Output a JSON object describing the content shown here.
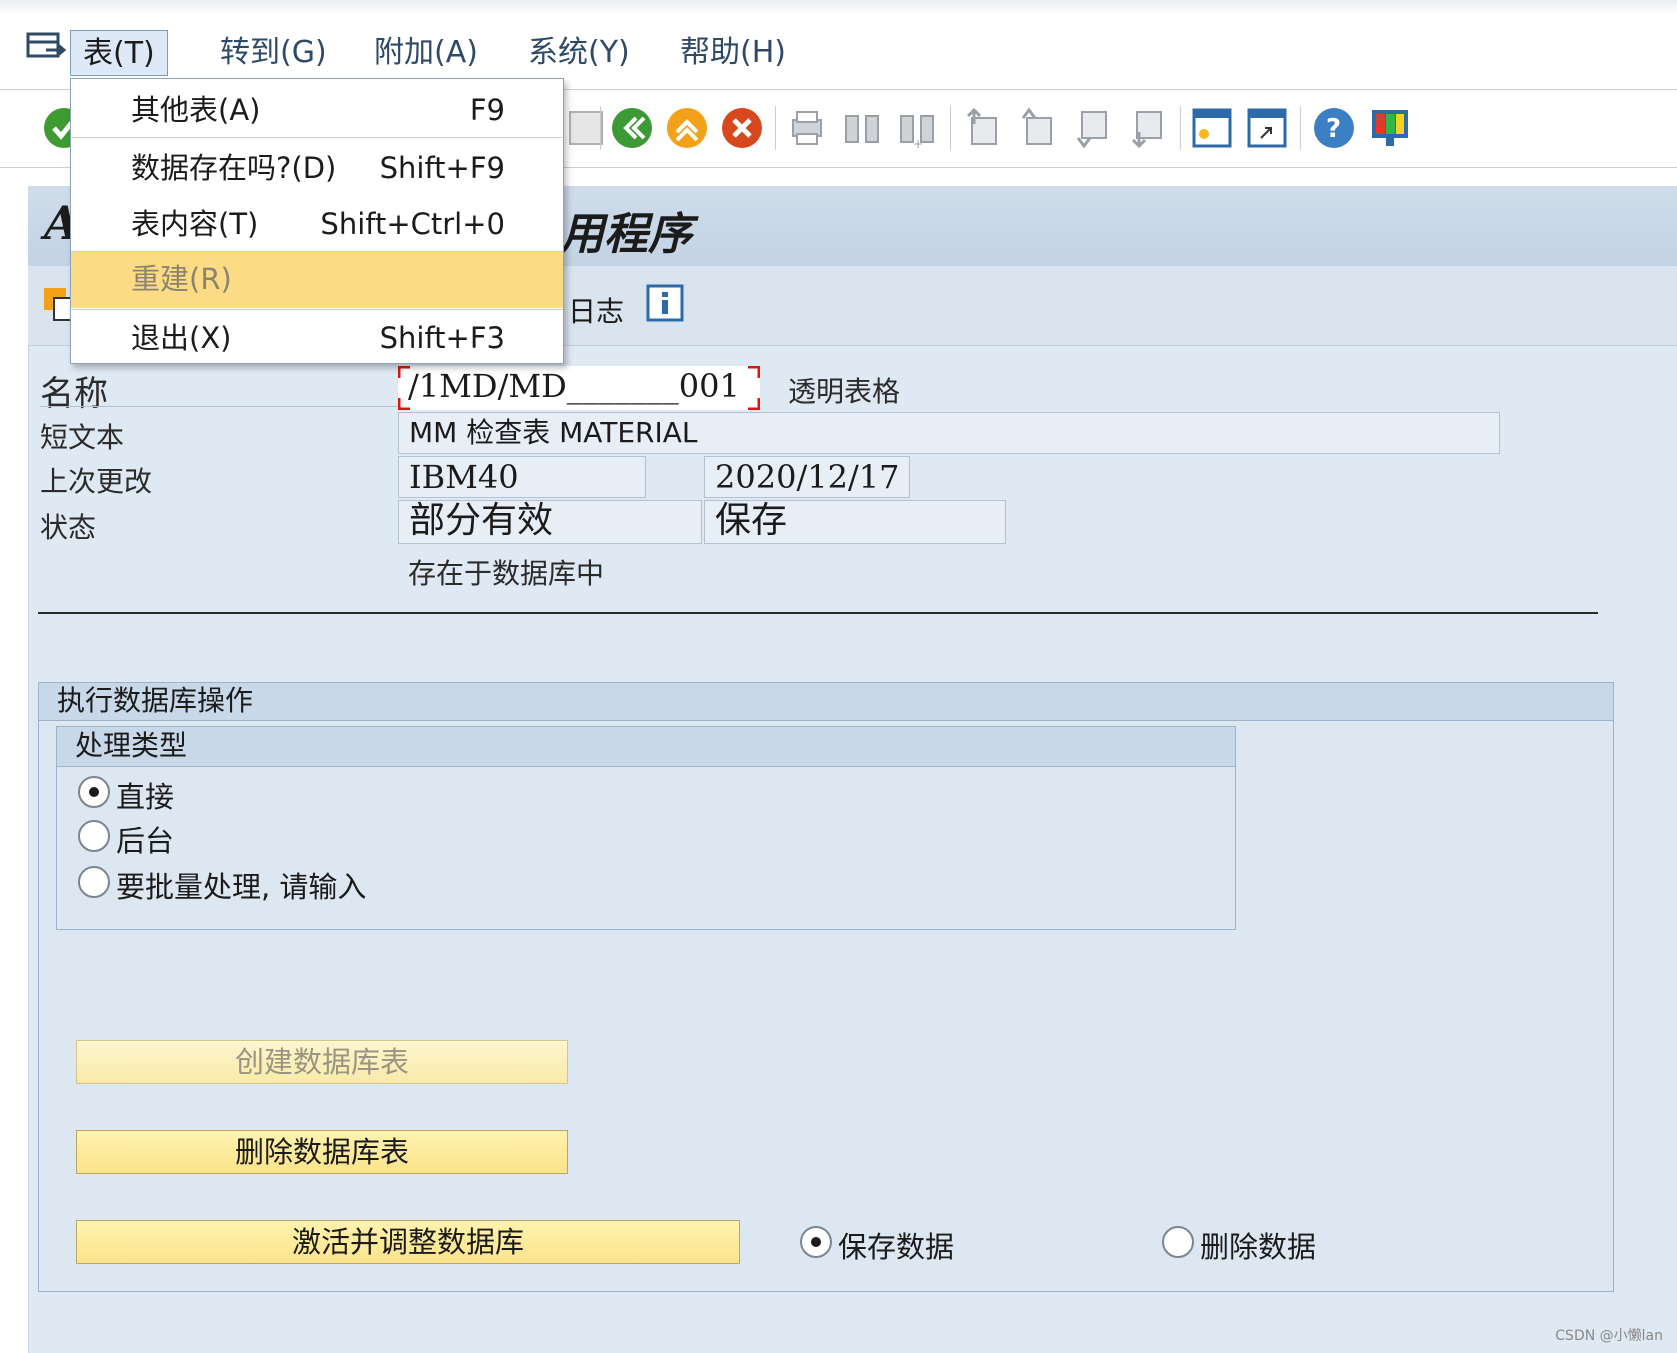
{
  "menubar": {
    "items": [
      {
        "label": "表(T)",
        "open": true
      },
      {
        "label": "转到(G)"
      },
      {
        "label": "附加(A)"
      },
      {
        "label": "系统(Y)"
      },
      {
        "label": "帮助(H)"
      }
    ]
  },
  "dropdown": {
    "items": [
      {
        "label": "其他表(A)",
        "shortcut": "F9"
      },
      {
        "label": "数据存在吗?(D)",
        "shortcut": "Shift+F9"
      },
      {
        "label": "表内容(T)",
        "shortcut": "Shift+Ctrl+0"
      },
      {
        "label": "重建(R)",
        "shortcut": "",
        "highlighted": true,
        "disabled": true
      },
      {
        "label": "退出(X)",
        "shortcut": "Shift+F3"
      }
    ]
  },
  "title": {
    "visible_prefix": "A",
    "visible_suffix": "用程序"
  },
  "app_toolbar": {
    "log_label": "日志"
  },
  "form": {
    "name_label": "名称",
    "name_value": "/1MD/MD_______001",
    "name_type": "透明表格",
    "short_text_label": "短文本",
    "short_text_value": "MM 检查表 MATERIAL",
    "last_changed_label": "上次更改",
    "last_changed_user": "IBM40",
    "last_changed_date": "2020/12/17",
    "status_label": "状态",
    "status_value1": "部分有效",
    "status_value2": "保存",
    "status_note": "存在于数据库中"
  },
  "db_ops": {
    "title": "执行数据库操作",
    "proc_type_title": "处理类型",
    "options": [
      {
        "label": "直接",
        "selected": true
      },
      {
        "label": "后台",
        "selected": false
      },
      {
        "label": "要批量处理, 请输入",
        "selected": false
      }
    ],
    "create_btn": "创建数据库表",
    "delete_btn": "删除数据库表",
    "activate_btn": "激活并调整数据库",
    "save_data": "保存数据",
    "delete_data": "删除数据"
  },
  "watermark": "CSDN @小懒lan",
  "colors": {
    "accent_yellow": "#fbdc84",
    "panel_blue": "#dfe9f3",
    "required_red": "#d61515"
  }
}
